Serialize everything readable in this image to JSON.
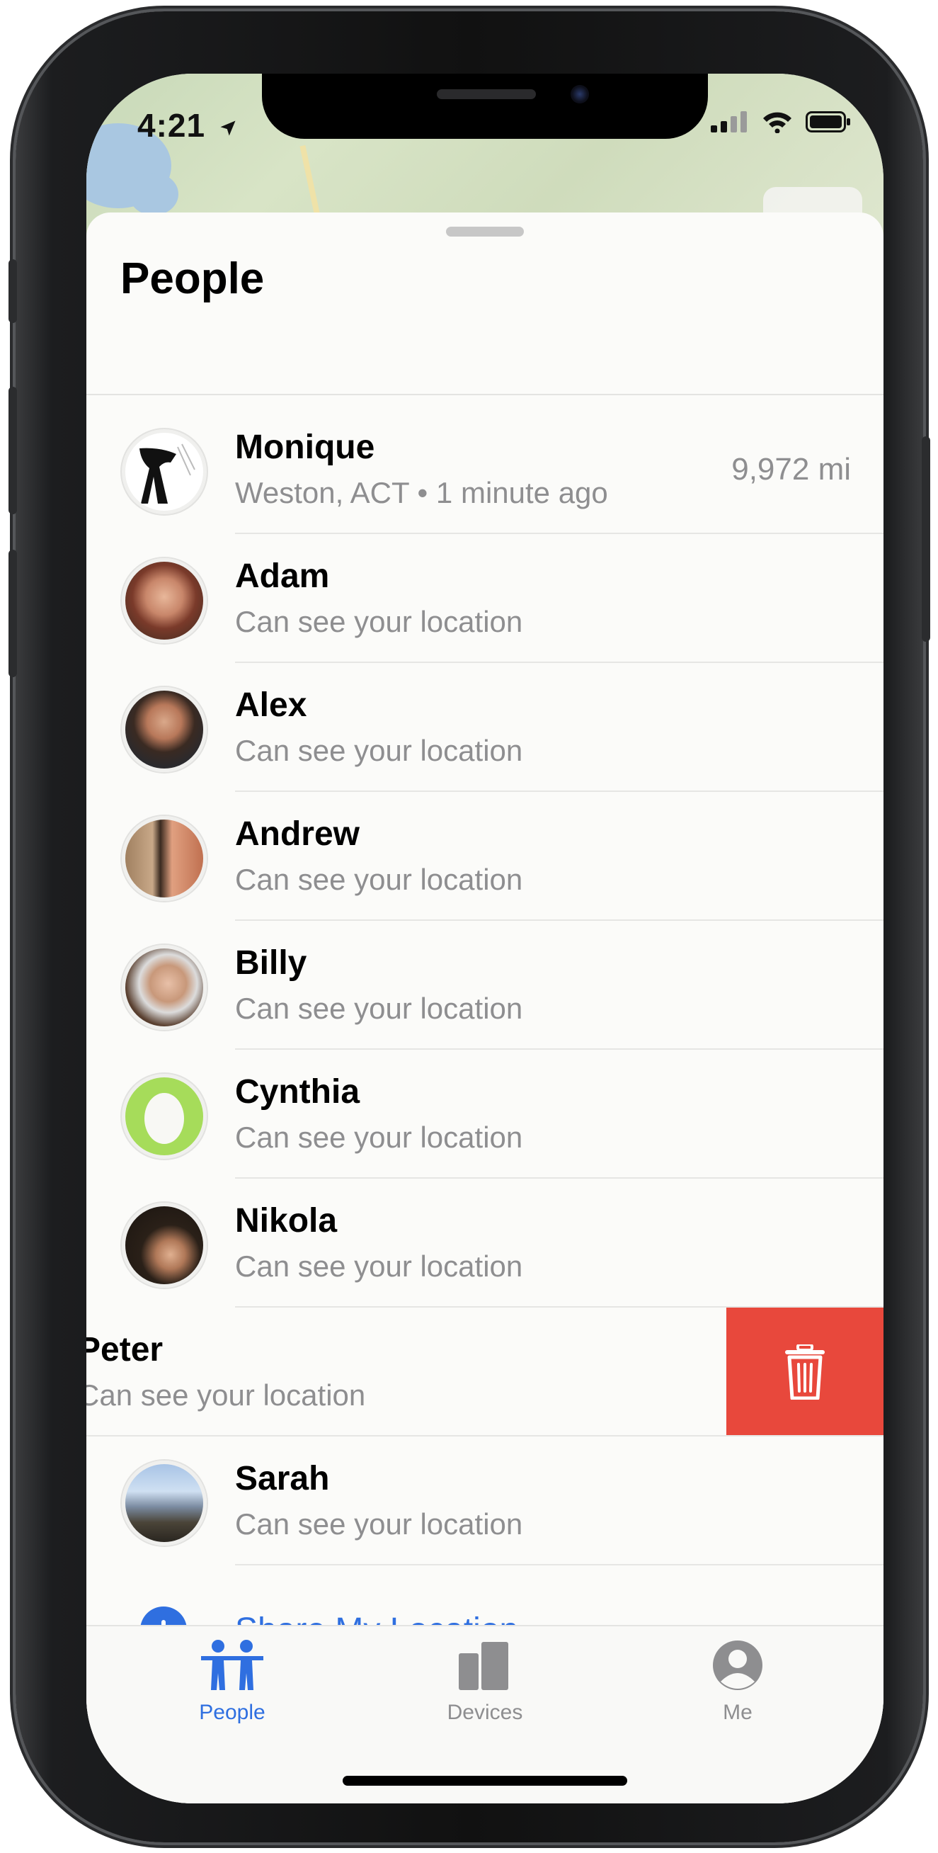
{
  "status_bar": {
    "time": "4:21"
  },
  "sheet": {
    "title": "People"
  },
  "people": [
    {
      "name": "Monique",
      "subtitle": "Weston, ACT • 1 minute ago",
      "distance": "9,972 mi"
    },
    {
      "name": "Adam",
      "subtitle": "Can see your location"
    },
    {
      "name": "Alex",
      "subtitle": "Can see your location"
    },
    {
      "name": "Andrew",
      "subtitle": "Can see your location"
    },
    {
      "name": "Billy",
      "subtitle": "Can see your location"
    },
    {
      "name": "Cynthia",
      "subtitle": "Can see your location"
    },
    {
      "name": "Nikola",
      "subtitle": "Can see your location"
    },
    {
      "name": "Peter",
      "subtitle": "Can see your location"
    },
    {
      "name": "Sarah",
      "subtitle": "Can see your location"
    }
  ],
  "share": {
    "label": "Share My Location"
  },
  "tabs": [
    {
      "label": "People",
      "icon": "people-icon",
      "active": true
    },
    {
      "label": "Devices",
      "icon": "devices-icon",
      "active": false
    },
    {
      "label": "Me",
      "icon": "me-icon",
      "active": false
    }
  ],
  "colors": {
    "accent": "#2f6fe0",
    "delete": "#e8483c",
    "secondary_text": "#8e8e90"
  }
}
